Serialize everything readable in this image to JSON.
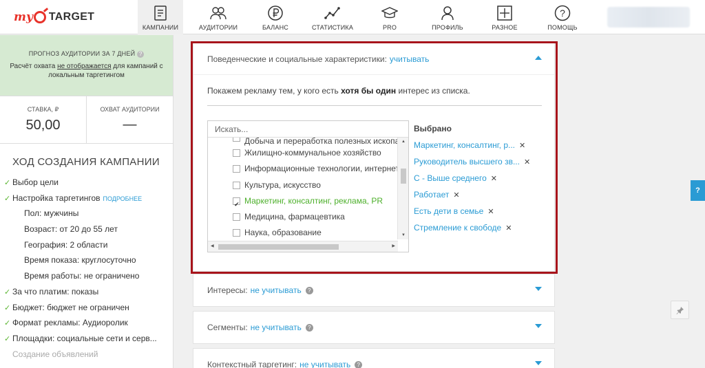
{
  "brand": {
    "my": "my",
    "target": "TARGET",
    "accent": "#e8322a"
  },
  "nav": [
    {
      "label": "Кампании",
      "icon": "document-icon",
      "active": true
    },
    {
      "label": "Аудитории",
      "icon": "people-icon"
    },
    {
      "label": "Баланс",
      "icon": "ruble-icon"
    },
    {
      "label": "Статистика",
      "icon": "line-chart-icon"
    },
    {
      "label": "PRO",
      "icon": "graduation-cap-icon"
    },
    {
      "label": "Профиль",
      "icon": "user-icon"
    },
    {
      "label": "Разное",
      "icon": "grid-icon"
    },
    {
      "label": "Помощь",
      "icon": "question-icon"
    }
  ],
  "sidebar": {
    "forecast_title": "Прогноз аудитории за 7 дней",
    "forecast_pre": "Расчёт охвата ",
    "forecast_link": "не отображается",
    "forecast_post": " для кампаний с локальным таргетингом",
    "bid_label": "Ставка, ₽",
    "bid_value": "50,00",
    "reach_label": "Охват аудитории",
    "reach_value": "—",
    "progress_title": "Ход создания кампании",
    "steps": [
      {
        "text": "Выбор цели",
        "state": "done"
      },
      {
        "text": "Настройка таргетингов",
        "state": "done",
        "link": "подробнее"
      },
      {
        "text": "Пол: мужчины",
        "state": "sub"
      },
      {
        "text": "Возраст: от 20 до 55 лет",
        "state": "sub"
      },
      {
        "text": "География: 2 области",
        "state": "sub"
      },
      {
        "text": "Время показа: круглосуточно",
        "state": "sub"
      },
      {
        "text": "Время работы: не ограничено",
        "state": "sub"
      },
      {
        "text": "За что платим: показы",
        "state": "done"
      },
      {
        "text": "Бюджет: бюджет не ограничен",
        "state": "done"
      },
      {
        "text": "Формат рекламы: Аудиоролик",
        "state": "done"
      },
      {
        "text": "Площадки: социальные сети и серв...",
        "state": "done"
      },
      {
        "text": "Создание объявлений",
        "state": "muted"
      }
    ]
  },
  "behavior": {
    "label": "Поведенческие и социальные характеристики:",
    "value": "учитывать",
    "intro_pre": "Покажем рекламу тем, у кого есть ",
    "intro_bold": "хотя бы один",
    "intro_post": " интерес из списка.",
    "search_placeholder": "Искать...",
    "items": [
      {
        "text": "Добыча и переработка полезных ископаемых",
        "checked": false,
        "partial": true
      },
      {
        "text": "Жилищно-коммунальное хозяйство",
        "checked": false
      },
      {
        "text": "Информационные технологии, интернет",
        "checked": false
      },
      {
        "text": "Культура, искусство",
        "checked": false
      },
      {
        "text": "Маркетинг, консалтинг, реклама, PR",
        "checked": true
      },
      {
        "text": "Медицина, фармацевтика",
        "checked": false
      },
      {
        "text": "Наука, образование",
        "checked": false
      }
    ],
    "selected_title": "Выбрано",
    "selected": [
      "Маркетинг, консалтинг, р...",
      "Руководитель высшего зв...",
      "С - Выше среднего",
      "Работает",
      "Есть дети в семье",
      "Стремление к свободе"
    ]
  },
  "interests": {
    "label": "Интересы:",
    "value": "не учитывать"
  },
  "segments": {
    "label": "Сегменты:",
    "value": "не учитывать"
  },
  "context": {
    "label": "Контекстный таргетинг:",
    "value": "не учитывать"
  },
  "help_tab": "?",
  "colors": {
    "link": "#2a9bd4",
    "check": "#5bb531",
    "highlight": "#a8141b",
    "forecast_bg": "#d6ead2"
  }
}
